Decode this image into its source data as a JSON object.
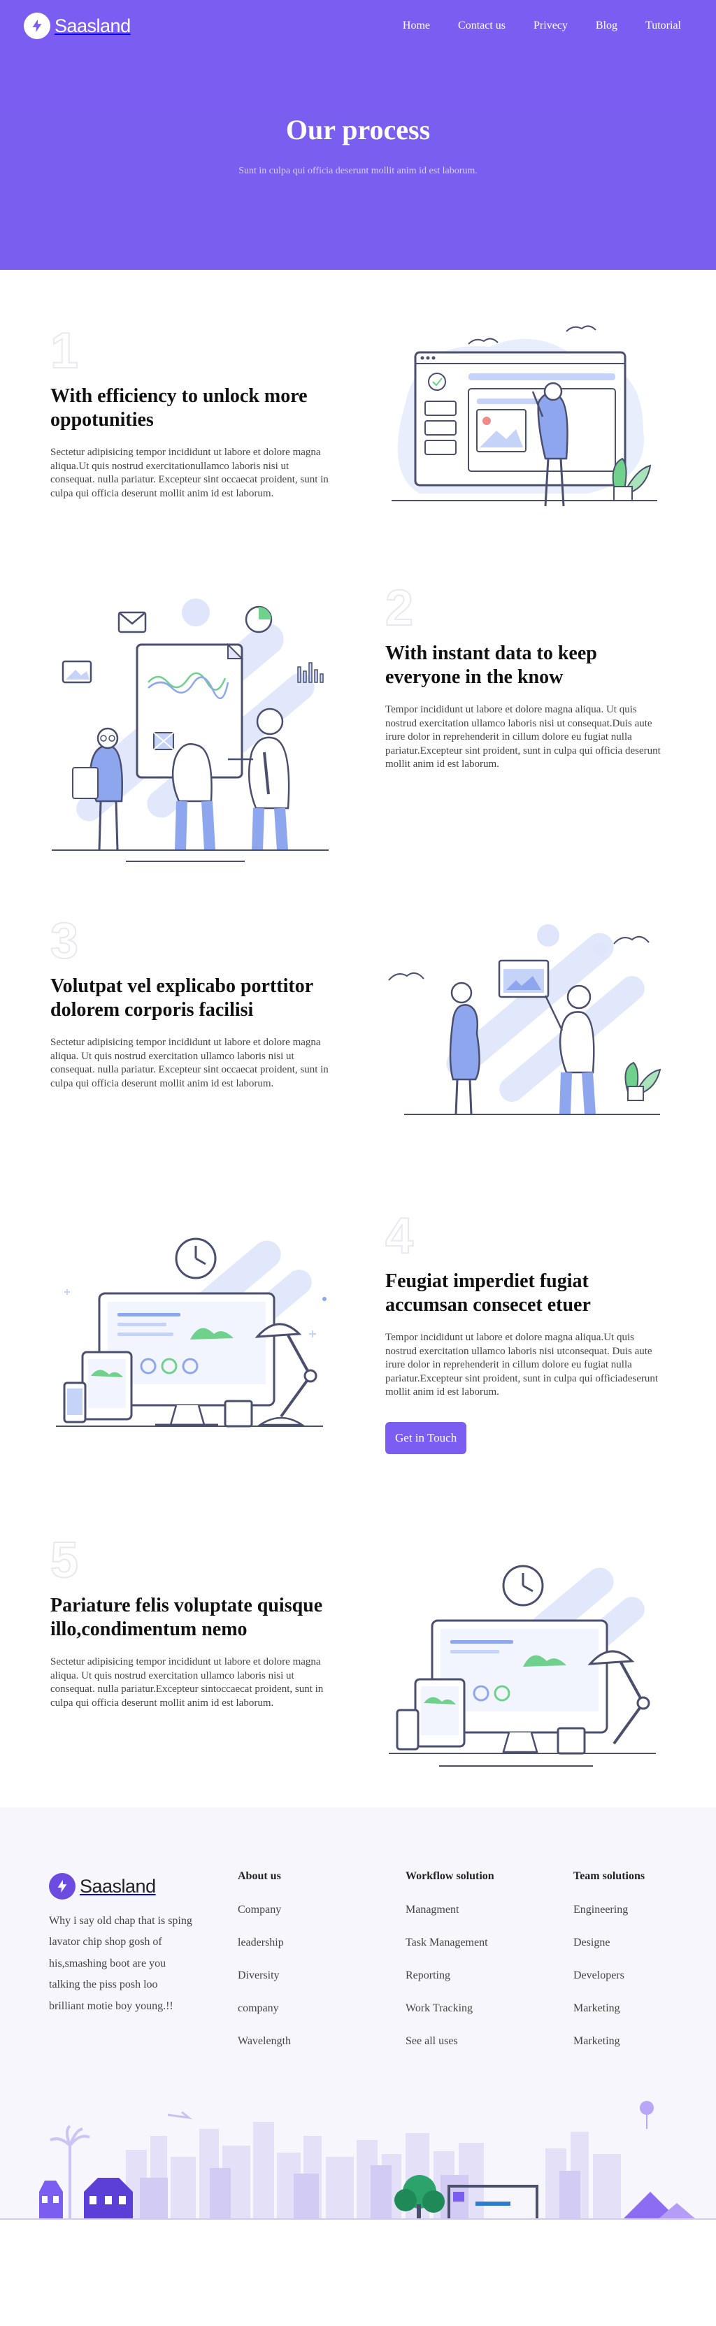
{
  "brand": {
    "name": "Saasland"
  },
  "nav": {
    "items": [
      {
        "label": "Home"
      },
      {
        "label": "Contact us"
      },
      {
        "label": "Privecy"
      },
      {
        "label": "Blog"
      },
      {
        "label": "Tutorial"
      }
    ]
  },
  "hero": {
    "title": "Our process",
    "subtitle": "Sunt in culpa qui officia deserunt mollit anim id est laborum."
  },
  "steps": [
    {
      "number": "1",
      "title": "With efficiency to unlock more oppotunities",
      "body": "Sectetur adipisicing tempor incididunt ut labore et dolore magna aliqua.Ut quis nostrud exercitationullamco laboris nisi ut consequat. nulla pariatur. Excepteur sint occaecat proident, sunt in culpa qui officia deserunt mollit anim id est laborum."
    },
    {
      "number": "2",
      "title": "With instant data to keep everyone in the know",
      "body": "Tempor incididunt ut labore et dolore magna aliqua. Ut quis nostrud exercitation ullamco laboris nisi ut consequat.Duis aute irure dolor in reprehenderit in cillum dolore eu fugiat nulla pariatur.Excepteur sint proident, sunt in culpa qui officia deserunt mollit anim id est laborum."
    },
    {
      "number": "3",
      "title": "Volutpat vel explicabo porttitor dolorem corporis facilisi",
      "body": "Sectetur adipisicing tempor incididunt ut labore et dolore magna aliqua. Ut quis nostrud exercitation ullamco laboris nisi ut consequat. nulla pariatur. Excepteur sint occaecat proident, sunt in culpa qui officia deserunt mollit anim id est laborum."
    },
    {
      "number": "4",
      "title": "Feugiat imperdiet fugiat accumsan consecet etuer",
      "body": "Tempor incididunt ut labore et dolore magna aliqua.Ut quis nostrud exercitation ullamco laboris nisi utconsequat. Duis aute irure dolor in reprehenderit in cillum dolore eu fugiat nulla pariatur.Excepteur sint proident, sunt in culpa qui officiadeserunt mollit anim id est laborum.",
      "cta": "Get in Touch"
    },
    {
      "number": "5",
      "title": "Pariature felis voluptate quisque illo,condimentum nemo",
      "body": "Sectetur adipisicing tempor incididunt ut labore et dolore magna aliqua. Ut quis nostrud exercitation ullamco laboris nisi ut consequat. nulla pariatur.Excepteur sintoccaecat proident, sunt in culpa qui officia deserunt mollit anim id est laborum."
    }
  ],
  "footer": {
    "brand": "Saasland",
    "about": "Why i say old chap that is sping lavator chip shop gosh of his,smashing boot are you talking the piss posh loo brilliant motie boy young.!!",
    "columns": [
      {
        "title": "About us",
        "links": [
          "Company",
          "leadership",
          "Diversity",
          "company",
          "Wavelength"
        ]
      },
      {
        "title": "Workflow solution",
        "links": [
          "Managment",
          "Task Management",
          "Reporting",
          "Work Tracking",
          "See all uses"
        ]
      },
      {
        "title": "Team solutions",
        "links": [
          "Engineering",
          "Designe",
          "Developers",
          "Marketing",
          "Marketing"
        ]
      }
    ]
  },
  "colors": {
    "brand_purple": "#7b5df1",
    "light_purple": "#d9d0ff",
    "footer_bg": "#f6f6fc"
  }
}
